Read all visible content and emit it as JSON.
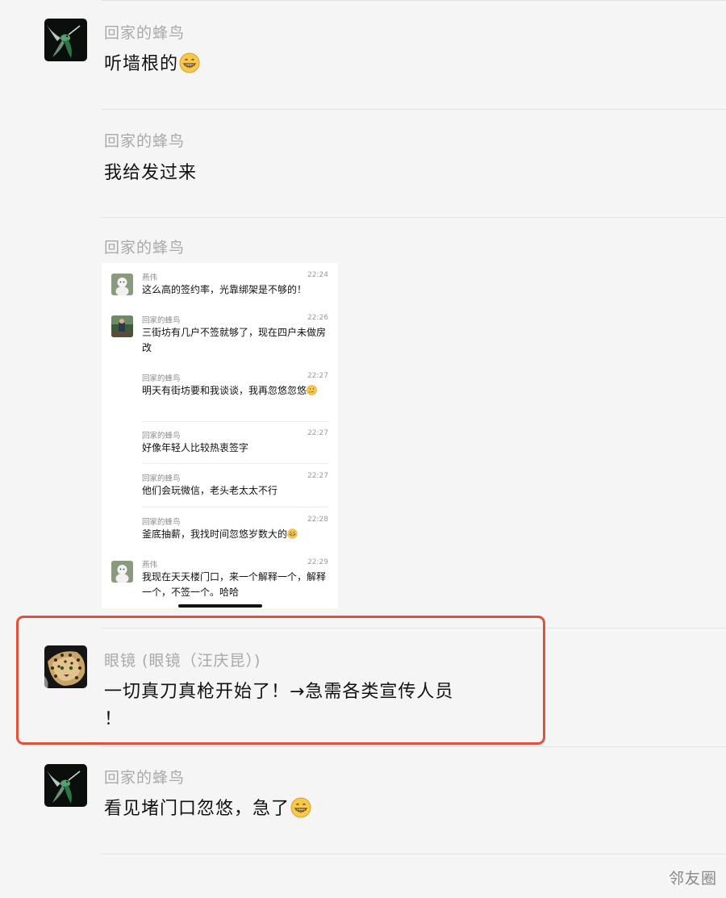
{
  "messages": [
    {
      "sender": "回家的蜂鸟",
      "text": "听墙根的",
      "emoji": "grin-emoji"
    },
    {
      "sender": "回家的蜂鸟",
      "text": "我给发过来"
    },
    {
      "sender": "回家的蜂鸟"
    },
    {
      "sender": "眼镜 (眼镜（汪庆昆）)",
      "text_line1": "一切真刀真枪开始了！→急需各类宣传人员",
      "text_line2": "！"
    },
    {
      "sender": "回家的蜂鸟",
      "text": "看见堵门口忽悠，急了",
      "emoji": "grin-emoji"
    }
  ],
  "screenshot": {
    "messages": [
      {
        "sender": "燕伟",
        "time": "22:24",
        "text": "这么高的签约率，光靠绑架是不够的！"
      },
      {
        "sender": "回家的蜂鸟",
        "time": "22:26",
        "text": "三街坊有几户不签就够了，现在四户未做房改"
      },
      {
        "sender": "回家的蜂鸟",
        "time": "22:27",
        "text": "明天有街坊要和我谈谈，我再忽悠忽悠"
      },
      {
        "sender": "回家的蜂鸟",
        "time": "22:27",
        "text": "好像年轻人比较热衷签字"
      },
      {
        "sender": "回家的蜂鸟",
        "time": "22:27",
        "text": "他们会玩微信，老头老太太不行"
      },
      {
        "sender": "回家的蜂鸟",
        "time": "22:28",
        "text": "釜底抽薪，我找时间忽悠岁数大的"
      },
      {
        "sender": "燕伟",
        "time": "22:29",
        "text": "我现在天天楼门口，来一个解释一个，解释一个，不签一个。哈哈"
      }
    ]
  },
  "watermark": "邻友圈",
  "colors": {
    "highlight": "#e0513e",
    "background": "#f5f5f5"
  }
}
